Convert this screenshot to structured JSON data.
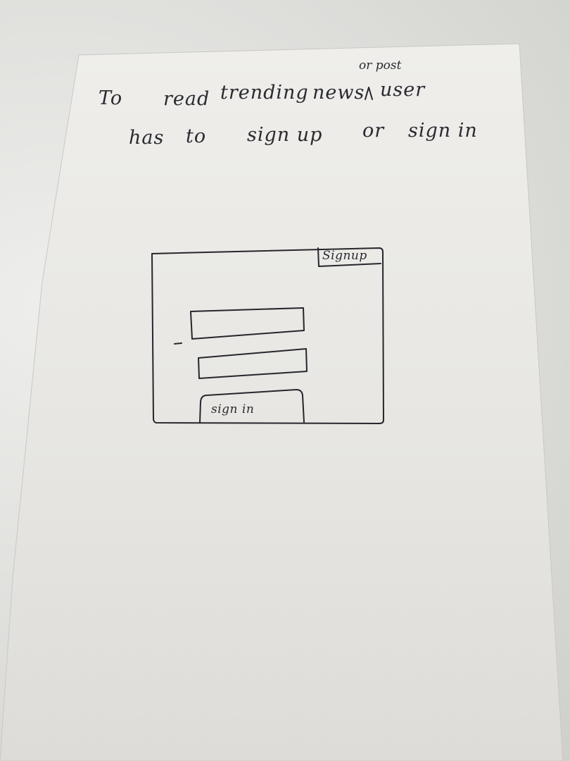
{
  "note": {
    "line1": {
      "w1": "To",
      "w2": "read",
      "w3": "trending",
      "w4": "news",
      "w5": "user"
    },
    "insertion": "or post",
    "line2": {
      "w1": "has",
      "w2": "to",
      "w3": "sign up",
      "w4": "or",
      "w5": "sign in"
    }
  },
  "mockup": {
    "signup_label": "Signup",
    "signin_label": "sign in"
  }
}
